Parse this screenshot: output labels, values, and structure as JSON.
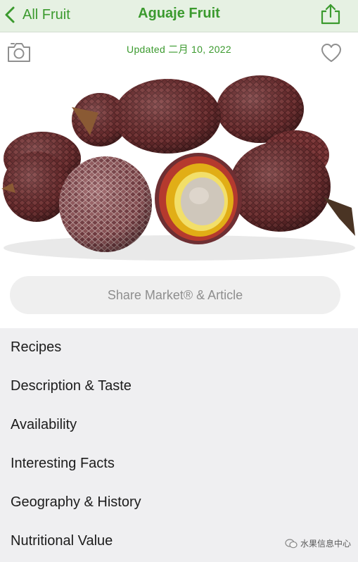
{
  "nav": {
    "back_label": "All Fruit",
    "title": "Aguaje Fruit"
  },
  "updated_text": "Updated 二月 10, 2022",
  "share_button_label": "Share Market® & Article",
  "menu_items": [
    "Recipes",
    "Description & Taste",
    "Availability",
    "Interesting Facts",
    "Geography & History",
    "Nutritional Value"
  ],
  "watermark": "水果信息中心",
  "colors": {
    "accent": "#3b9a2e",
    "nav_bg": "#e6f1e3",
    "menu_bg": "#efeff1",
    "button_bg": "#efefef"
  },
  "icons": [
    "chevron-left-icon",
    "share-icon",
    "camera-icon",
    "heart-icon"
  ]
}
